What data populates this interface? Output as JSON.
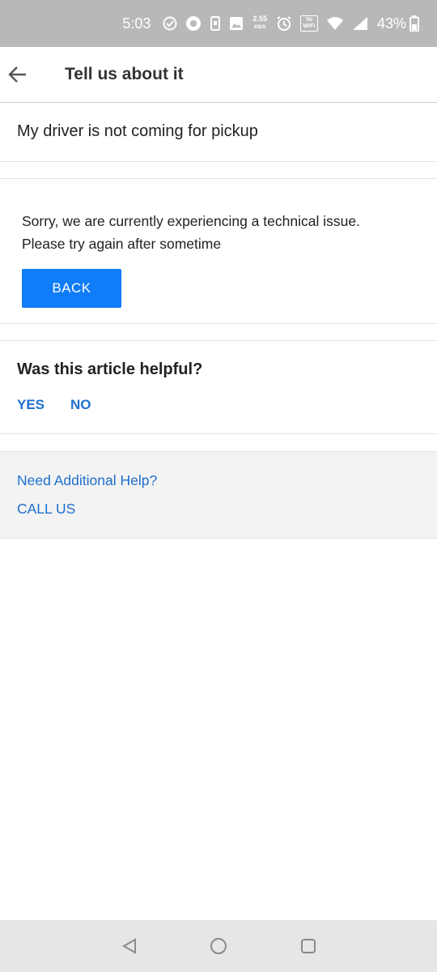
{
  "status_bar": {
    "time": "5:03",
    "speed_value": "2.55",
    "speed_unit": "KB/S",
    "volte_label": "Vo WiFi",
    "battery_percent": "43%"
  },
  "app_bar": {
    "title": "Tell us about it"
  },
  "issue": {
    "title": "My driver is not coming for pickup"
  },
  "message": {
    "line1": "Sorry, we are currently experiencing a technical issue.",
    "line2": "Please try again after sometime",
    "back_label": "BACK"
  },
  "helpful": {
    "question": "Was this article helpful?",
    "yes_label": "YES",
    "no_label": "NO"
  },
  "help": {
    "need_help_label": "Need Additional Help?",
    "call_us_label": "CALL US"
  },
  "colors": {
    "accent_button": "#0f7cf8",
    "link": "#1e6fcf",
    "status_bar": "#b8b8b8"
  }
}
